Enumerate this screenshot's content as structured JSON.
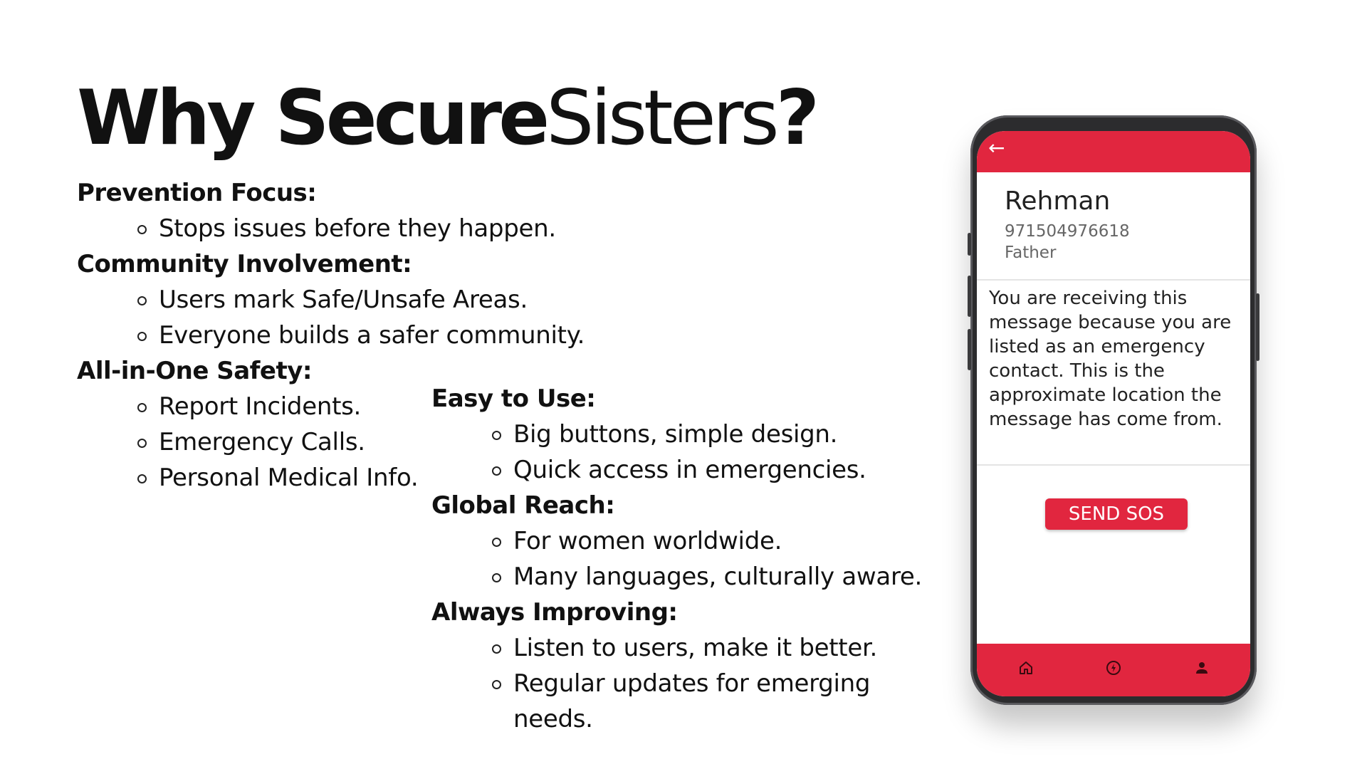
{
  "slide": {
    "title_bold": "Why Secure",
    "title_light": "Sisters",
    "title_q": "?"
  },
  "left_sections": [
    {
      "heading": "Prevention Focus:",
      "items": [
        "Stops issues before they happen."
      ]
    },
    {
      "heading": "Community Involvement:",
      "items": [
        "Users mark Safe/Unsafe Areas.",
        "Everyone builds a safer community."
      ]
    },
    {
      "heading": "All-in-One Safety:",
      "items": [
        "Report Incidents.",
        "Emergency Calls.",
        "Personal Medical Info."
      ]
    }
  ],
  "right_sections": [
    {
      "heading": "Easy to Use:",
      "items": [
        "Big buttons, simple design.",
        "Quick access in emergencies."
      ]
    },
    {
      "heading": "Global Reach:",
      "items": [
        "For women worldwide.",
        "Many languages, culturally aware."
      ]
    },
    {
      "heading": "Always Improving:",
      "items": [
        "Listen to users, make it better.",
        "Regular updates for emerging needs."
      ]
    }
  ],
  "phone": {
    "back_icon": "arrow-left-icon",
    "contact": {
      "name": "Rehman",
      "phone": "971504976618",
      "relation": "Father"
    },
    "message": "You are receiving this message because you are listed as an emergency contact. This is the approximate location the message has come from.",
    "sos_label": "SEND SOS",
    "nav_icons": [
      "home-icon",
      "lightning-icon",
      "person-icon"
    ],
    "accent_color": "#e1263f"
  }
}
